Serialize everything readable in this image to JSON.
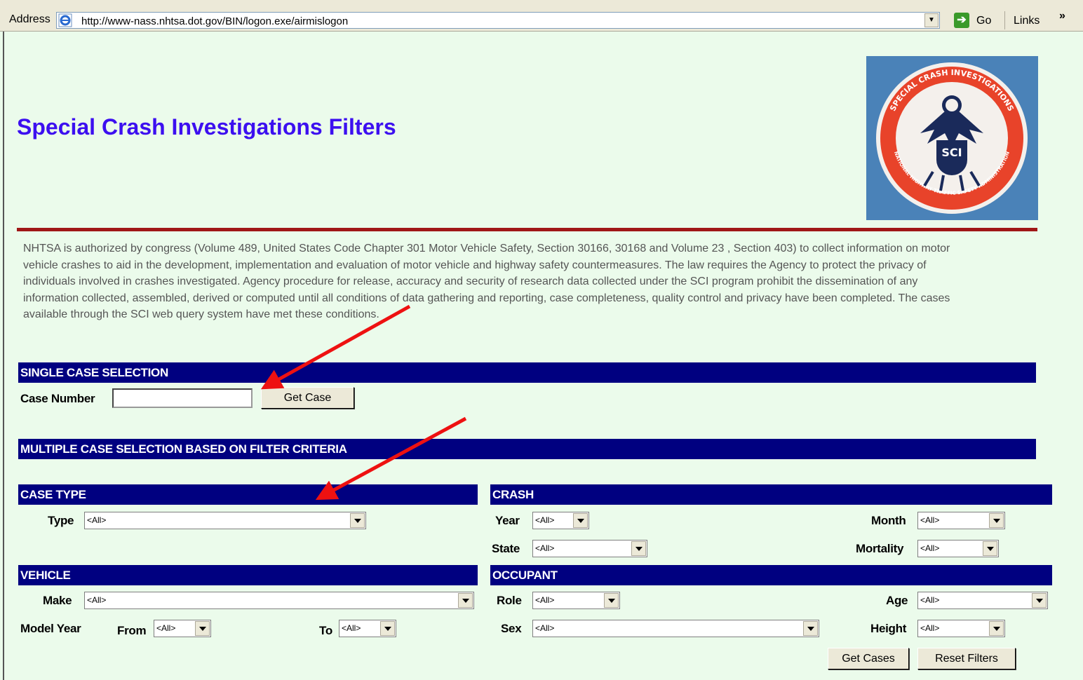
{
  "address_bar": {
    "label": "Address",
    "url": "http://www-nass.nhtsa.dot.gov/BIN/logon.exe/airmislogon",
    "go_label": "Go",
    "links_label": "Links",
    "chevron": "»"
  },
  "page": {
    "title": "Special Crash Investigations Filters",
    "logo_text_top": "SPECIAL CRASH INVESTIGATIONS",
    "logo_text_bottom": "NATIONAL HIGHWAY TRAFFIC SAFETY ADMINISTRATION",
    "logo_center": "SCI",
    "intro": "NHTSA is authorized by congress (Volume 489, United States Code Chapter 301 Motor Vehicle Safety, Section 30166, 30168 and Volume 23 , Section 403) to collect information on motor vehicle crashes to aid in the development, implementation and evaluation of motor vehicle and highway safety countermeasures. The law requires the Agency to protect the privacy of individuals involved in crashes investigated. Agency procedure for release, accuracy and security of research data collected under the SCI program prohibit the dissemination of any information collected, assembled, derived or computed until all conditions of data gathering and reporting, case completeness, quality control and privacy have been completed. The cases available through the SCI web query system have met these conditions."
  },
  "single_case": {
    "header": "SINGLE CASE SELECTION",
    "case_number_label": "Case Number",
    "case_number_value": "",
    "get_case_button": "Get Case"
  },
  "multiple_case": {
    "header": "MULTIPLE CASE SELECTION BASED ON FILTER CRITERIA"
  },
  "case_type": {
    "header": "CASE TYPE",
    "type_label": "Type",
    "type_value": "<All>"
  },
  "crash": {
    "header": "CRASH",
    "year_label": "Year",
    "year_value": "<All>",
    "month_label": "Month",
    "month_value": "<All>",
    "state_label": "State",
    "state_value": "<All>",
    "mortality_label": "Mortality",
    "mortality_value": "<All>"
  },
  "vehicle": {
    "header": "VEHICLE",
    "make_label": "Make",
    "make_value": "<All>",
    "model_year_label": "Model Year",
    "from_label": "From",
    "from_value": "<All>",
    "to_label": "To",
    "to_value": "<All>"
  },
  "occupant": {
    "header": "OCCUPANT",
    "role_label": "Role",
    "role_value": "<All>",
    "age_label": "Age",
    "age_value": "<All>",
    "sex_label": "Sex",
    "sex_value": "<All>",
    "height_label": "Height",
    "height_value": "<All>"
  },
  "actions": {
    "get_cases_button": "Get Cases",
    "reset_filters_button": "Reset Filters"
  },
  "colors": {
    "background": "#ebfbeb",
    "header_bar": "#000080",
    "title": "#3c0ff0",
    "rule": "#a01717",
    "annotation_arrow": "#ee1111"
  }
}
